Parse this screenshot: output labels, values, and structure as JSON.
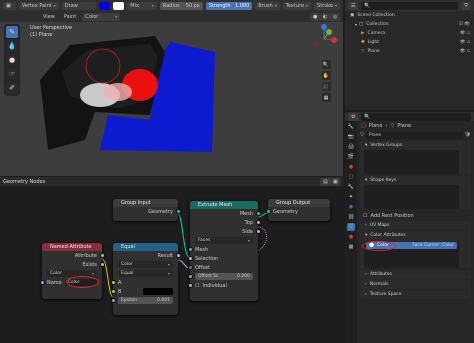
{
  "viewport": {
    "header": {
      "mode": "Vertex Paint",
      "brush": "Draw",
      "blend": "Mix",
      "radius_label": "Radius",
      "radius_value": "50 px",
      "strength_label": "Strength",
      "strength_value": "1.000",
      "menus": [
        "Brush",
        "Texture",
        "Stroke"
      ],
      "color_swatch": "#0000f0"
    },
    "header2": {
      "view": "View",
      "paint": "Paint",
      "color_mode": "Color"
    },
    "overlay_line1": "User Perspective",
    "overlay_line2": "(1) Plane",
    "tools": [
      "draw-brush",
      "blur",
      "average",
      "smear",
      "annotate"
    ],
    "gizmo_axes": [
      "X",
      "Y",
      "Z"
    ]
  },
  "outliner": {
    "title": "Scene Collection",
    "items": [
      {
        "label": "Collection",
        "level": 1,
        "icon": "collection-icon"
      },
      {
        "label": "Camera",
        "level": 2,
        "icon": "camera-icon"
      },
      {
        "label": "Light",
        "level": 2,
        "icon": "light-icon"
      },
      {
        "label": "Plane",
        "level": 2,
        "icon": "mesh-icon"
      }
    ]
  },
  "properties": {
    "breadcrumb_object": "Plane",
    "breadcrumb_mesh": "Plane",
    "datablock_name": "Plane",
    "sections": [
      {
        "title": "Vertex Groups"
      },
      {
        "title": "Shape Keys"
      },
      {
        "title": "Add Rest Position"
      },
      {
        "title": "UV Maps"
      },
      {
        "title": "Color Attributes"
      },
      {
        "title": "Attributes"
      },
      {
        "title": "Normals"
      },
      {
        "title": "Texture Space"
      }
    ],
    "color_attribute": {
      "name": "Color",
      "domain": "Face Corner",
      "type": "Color"
    },
    "accent_color": "#4772b3",
    "highlight_color": "#e0202a"
  },
  "node_editor": {
    "header": {
      "editor_name": "Geometry Nodes"
    },
    "nodes": {
      "group_input": {
        "title": "Group Input",
        "outputs": [
          "Geometry"
        ]
      },
      "extrude": {
        "title": "Extrude Mesh",
        "outputs": [
          "Mesh",
          "Top",
          "Side"
        ],
        "mode": "Faces",
        "inputs": [
          "Mesh",
          "Selection",
          "Offset"
        ],
        "offset_scale_label": "Offset Sc",
        "offset_scale_value": "0.200",
        "individual_label": "Individual"
      },
      "group_output": {
        "title": "Group Output",
        "inputs": [
          "Geometry"
        ]
      },
      "named_attr": {
        "title": "Named Attribute",
        "outputs": [
          "Attribute",
          "Exists"
        ],
        "type": "Color",
        "name_label": "Name",
        "name_value": "Color"
      },
      "equal": {
        "title": "Equal",
        "outputs": [
          "Result"
        ],
        "type": "Color",
        "mode": "Equal",
        "inputs": [
          "A",
          "B"
        ],
        "epsilon_label": "Epsilon",
        "epsilon_value": "0.001"
      }
    },
    "colors": {
      "geometry_header": "#1b6b63",
      "input_header": "#3c3c3c",
      "attribute_header": "#8a2c3c",
      "math_header": "#246283"
    }
  }
}
